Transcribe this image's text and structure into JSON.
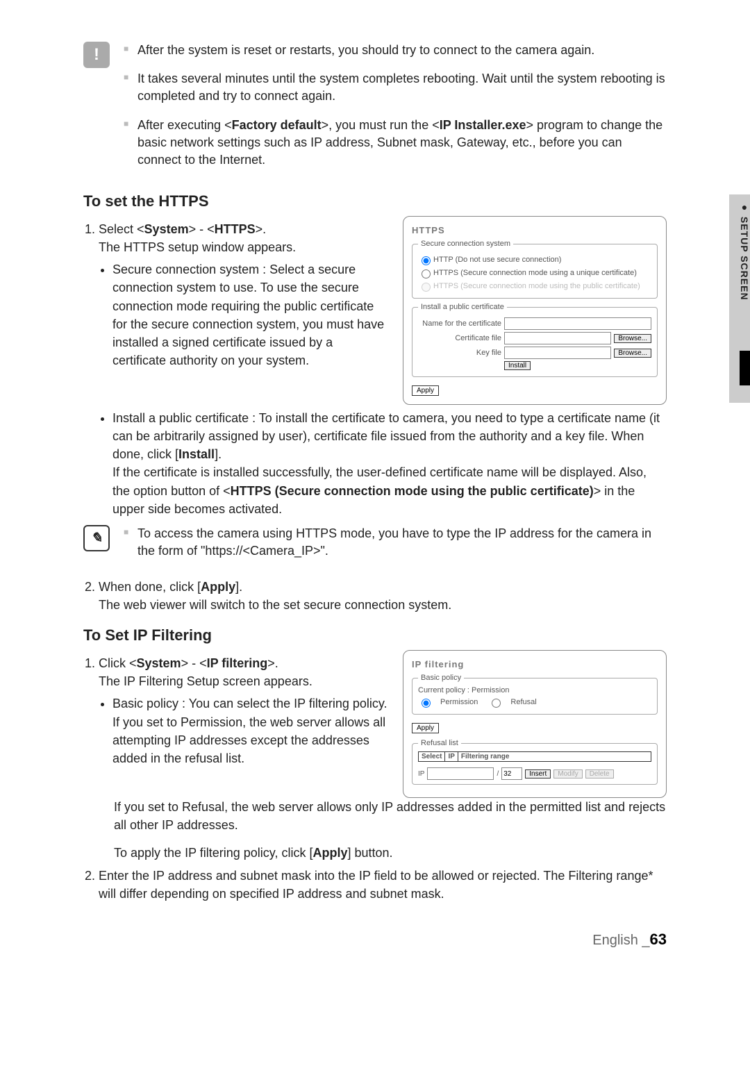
{
  "sideTab": "SETUP SCREEN",
  "notes": {
    "items": [
      "After the system is reset or restarts, you should try to connect to the camera again.",
      "It takes several minutes until the system completes rebooting. Wait until the system rebooting is completed and try to connect again.",
      "After executing <Factory default>, you must run the <IP Installer.exe> program to change the basic network settings such as IP address, Subnet mask, Gateway, etc., before you can connect to the Internet."
    ]
  },
  "https": {
    "heading": "To set the HTTPS",
    "step1_a": "Select <",
    "step1_b": "System",
    "step1_c": "> - <",
    "step1_d": "HTTPS",
    "step1_e": ">.",
    "step1_desc": "The HTTPS setup window appears.",
    "bullet1": "Secure connection system : Select a secure connection system to use. To use the secure connection mode requiring the public certificate for the secure connection system, you must have installed a signed certificate issued by a certificate authority on your system.",
    "bullet2_a": "Install a public certificate : To install the certificate to camera, you need to type a certificate name (it can be arbitrarily assigned by user), certificate file issued from the authority and a key file. When done, click [",
    "bullet2_b": "Install",
    "bullet2_c": "].",
    "bullet2_d": "If the certificate is installed successfully, the user-defined certificate name will be displayed. Also, the option button of <",
    "bullet2_e": "HTTPS (Secure connection mode using the public certificate)",
    "bullet2_f": "> in the upper side becomes activated.",
    "tip": "To access the camera using HTTPS mode, you have to type the IP address for the camera in the form of \"https://<Camera_IP>\".",
    "step2_a": "When done, click [",
    "step2_b": "Apply",
    "step2_c": "].",
    "step2_desc": "The web viewer will switch to the set secure connection system."
  },
  "httpsPanel": {
    "title": "HTTPS",
    "legend1": "Secure connection system",
    "r1": "HTTP  (Do not use secure connection)",
    "r2": "HTTPS (Secure connection mode using a unique certificate)",
    "r3": "HTTPS (Secure connection mode using the public certificate)",
    "legend2": "Install a public certificate",
    "lbl_name": "Name for the certificate",
    "lbl_cert": "Certificate file",
    "lbl_key": "Key file",
    "browse": "Browse...",
    "install": "Install",
    "apply": "Apply"
  },
  "ipf": {
    "heading": "To Set IP Filtering",
    "step1_a": "Click <",
    "step1_b": "System",
    "step1_c": "> - <",
    "step1_d": "IP filtering",
    "step1_e": ">.",
    "step1_desc": "The IP Filtering Setup screen appears.",
    "bullet1_a": "Basic policy : You can select the IP filtering policy.",
    "bullet1_b": "If you set to Permission, the web server allows all attempting IP addresses except the addresses added in the refusal list.",
    "bullet1_c": "If you set to Refusal, the web server allows only IP addresses added in the permitted list and rejects all other IP addresses.",
    "bullet1_d_a": "To apply the IP filtering policy, click [",
    "bullet1_d_b": "Apply",
    "bullet1_d_c": "] button.",
    "step2": "Enter the IP address and subnet mask into the IP field to be allowed or rejected. The Filtering range* will differ depending on specified IP address and subnet mask."
  },
  "ipfPanel": {
    "title": "IP filtering",
    "legend1": "Basic policy",
    "policy": "Current policy : Permission",
    "perm": "Permission",
    "ref": "Refusal",
    "apply": "Apply",
    "legend2": "Refusal list",
    "th1": "Select",
    "th2": "IP",
    "th3": "Filtering range",
    "ip_lbl": "IP",
    "slash": "/",
    "mask": "32",
    "insert": "Insert",
    "modify": "Modify",
    "delete": "Delete"
  },
  "footer": {
    "lang": "English _",
    "page": "63"
  }
}
